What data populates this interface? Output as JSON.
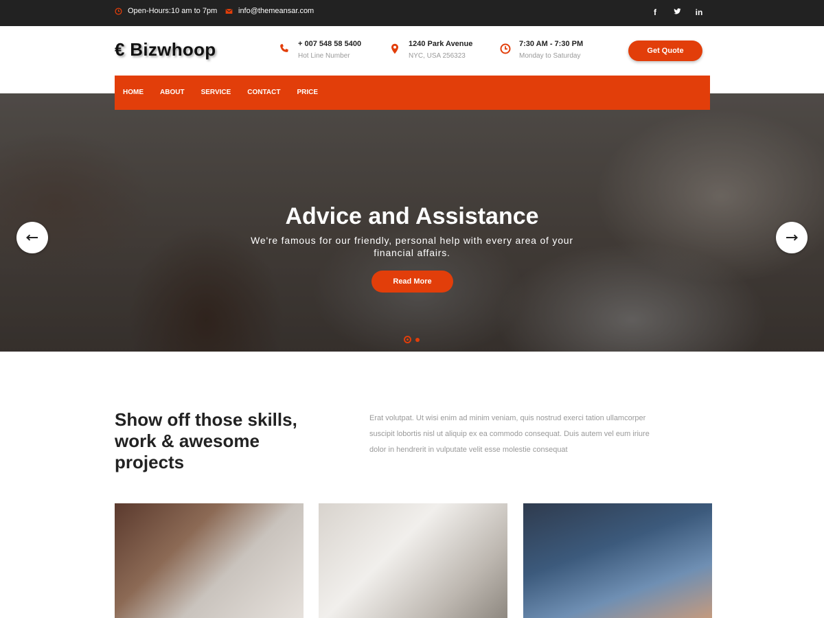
{
  "topbar": {
    "hours": "Open-Hours:10 am to 7pm",
    "email": "info@themeansar.com",
    "social": [
      {
        "icon": "facebook-icon",
        "glyph": "f"
      },
      {
        "icon": "twitter-icon",
        "glyph": "t"
      },
      {
        "icon": "linkedin-icon",
        "glyph": "in"
      }
    ]
  },
  "header": {
    "logo": "€ Bizwhoop",
    "phone": {
      "line1": "+ 007 548 58 5400",
      "line2": "Hot Line Number",
      "icon": "phone-icon"
    },
    "address": {
      "line1": "1240 Park Avenue",
      "line2": "NYC, USA 256323",
      "icon": "location-pin-icon"
    },
    "time": {
      "line1": "7:30 AM - 7:30 PM",
      "line2": "Monday to Saturday",
      "icon": "clock-icon"
    },
    "quote_button": "Get Quote"
  },
  "nav": {
    "items": [
      "HOME",
      "ABOUT",
      "SERVICE",
      "CONTACT",
      "PRICE"
    ]
  },
  "hero": {
    "title": "Advice and Assistance",
    "subtitle": "We're famous for our friendly, personal help with every area of your financial affairs.",
    "button": "Read More"
  },
  "intro": {
    "title": "Show off those skills, work & awesome projects",
    "text": "Erat volutpat. Ut wisi enim ad minim veniam, quis nostrud exerci tation ullamcorper suscipit lobortis nisl ut aliquip ex ea commodo consequat. Duis autem vel eum iriure dolor in hendrerit in vulputate velit esse molestie consequat"
  },
  "colors": {
    "accent": "#e23e0a",
    "topbar": "#222222"
  }
}
